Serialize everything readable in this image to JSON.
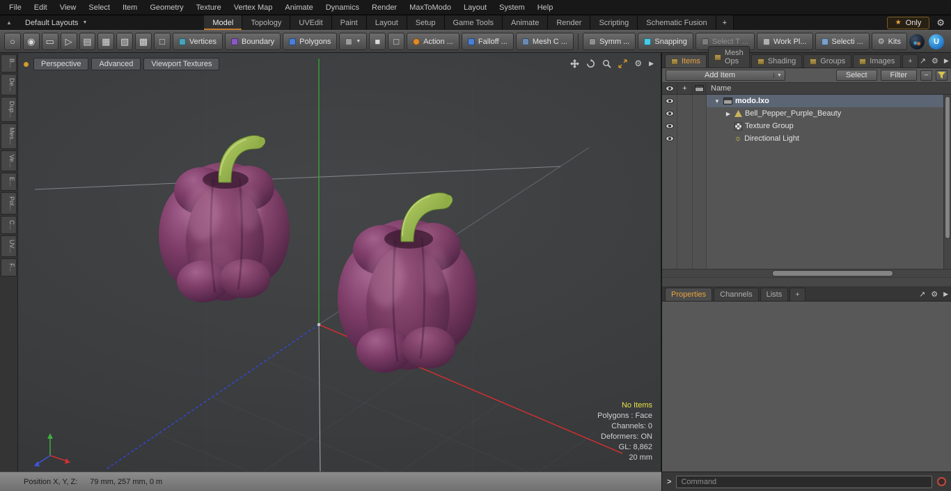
{
  "colors": {
    "accent_orange": "#d29b2a",
    "selection_row": "#5b6573",
    "pepper_purple": "#7e3d68",
    "stem_green": "#8fae45",
    "axis_x_red": "#cf3030",
    "axis_y_green": "#35aa35",
    "axis_z_blue": "#3547d2",
    "warning_yellow": "#e9e24a"
  },
  "icons": {
    "gear": "⚙",
    "star": "★",
    "play_small": "▶",
    "collapse_up": "▲",
    "dropdown": "▼",
    "expand": "↗",
    "plus": "+",
    "minus": "−",
    "prompt": ">",
    "sun": "☼",
    "logo_letter": "U",
    "tool_ellipse": "○",
    "tool_sphere": "◉",
    "tool_capsule": "▭",
    "tool_cursor": "▷",
    "tool_mirror": "▤",
    "tool_grid": "▦",
    "tool_hatch": "▧",
    "tool_fill": "▩",
    "tool_cube": "□",
    "tool_cube_solid": "■"
  },
  "menubar": {
    "items": [
      "File",
      "Edit",
      "View",
      "Select",
      "Item",
      "Geometry",
      "Texture",
      "Vertex Map",
      "Animate",
      "Dynamics",
      "Render",
      "MaxToModo",
      "Layout",
      "System",
      "Help"
    ]
  },
  "layout_bar": {
    "layouts_label": "Default Layouts",
    "tabs": [
      "Model",
      "Topology",
      "UVEdit",
      "Paint",
      "Layout",
      "Setup",
      "Game Tools",
      "Animate",
      "Render",
      "Scripting",
      "Schematic Fusion"
    ],
    "add_tab": "+",
    "only_label": "Only"
  },
  "toolbar": {
    "vertices": "Vertices",
    "boundary": "Boundary",
    "polygons": "Polygons",
    "action": "Action ...",
    "falloff": "Falloff ...",
    "mesh_constraint": "Mesh C ...",
    "symmetry": "Symm ...",
    "snapping": "Snapping",
    "select_through": "Select T ...",
    "work_plane": "Work Pl...",
    "selection_sets": "Selecti ...",
    "kits": "Kits"
  },
  "left_strip": {
    "labels": [
      "B...",
      "De...",
      "Dup...",
      "Mes...",
      "Ve...",
      "E...",
      "Pol...",
      "C...",
      "UV...",
      "F..."
    ]
  },
  "viewport": {
    "tabs": [
      "Perspective",
      "Advanced",
      "Viewport Textures"
    ],
    "stats": {
      "no_items": "No Items",
      "lines": [
        "Polygons : Face",
        "Channels: 0",
        "Deformers: ON",
        "GL: 8,862",
        "20 mm"
      ]
    }
  },
  "status_bar": {
    "label": "Position X, Y, Z:",
    "value": "79 mm, 257 mm, 0 m"
  },
  "right_panel": {
    "tabs": [
      "Items",
      "Mesh Ops",
      "Shading",
      "Groups",
      "Images",
      "+"
    ],
    "add_item_label": "Add Item",
    "select_label": "Select",
    "filter_label": "Filter",
    "name_header": "Name",
    "tree": [
      {
        "label": "modo.lxo",
        "disclosure": "▼"
      },
      {
        "label": "Bell_Pepper_Purple_Beauty",
        "disclosure": "▶"
      },
      {
        "label": "Texture Group",
        "disclosure": ""
      },
      {
        "label": "Directional Light",
        "disclosure": ""
      }
    ],
    "lower_tabs": [
      "Properties",
      "Channels",
      "Lists",
      "+"
    ],
    "command_placeholder": "Command"
  }
}
